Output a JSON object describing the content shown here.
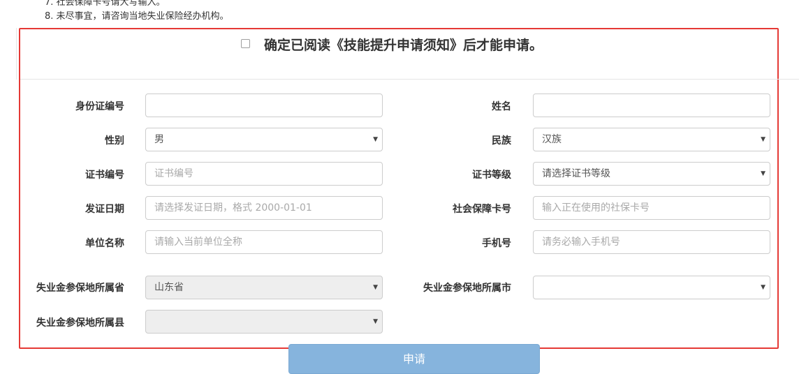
{
  "notes": [
    "7. 社会保障卡号请大写输入。",
    "8. 未尽事宜，请咨询当地失业保险经办机构。"
  ],
  "agreement": {
    "text": "确定已阅读《技能提升申请须知》后才能申请。",
    "checked": false
  },
  "form": {
    "id_number": {
      "label": "身份证编号",
      "value": ""
    },
    "name": {
      "label": "姓名",
      "value": ""
    },
    "gender": {
      "label": "性别",
      "value": "男"
    },
    "ethnicity": {
      "label": "民族",
      "value": "汉族"
    },
    "cert_number": {
      "label": "证书编号",
      "placeholder": "证书编号"
    },
    "cert_level": {
      "label": "证书等级",
      "value": "请选择证书等级"
    },
    "issue_date": {
      "label": "发证日期",
      "placeholder": "请选择发证日期，格式 2000-01-01"
    },
    "social_card": {
      "label": "社会保障卡号",
      "placeholder": "输入正在使用的社保卡号"
    },
    "employer": {
      "label": "单位名称",
      "placeholder": "请输入当前单位全称"
    },
    "phone": {
      "label": "手机号",
      "placeholder": "请务必输入手机号"
    },
    "province": {
      "label": "失业金参保地所属省",
      "value": "山东省"
    },
    "city": {
      "label": "失业金参保地所属市",
      "value": ""
    },
    "county": {
      "label": "失业金参保地所属县",
      "value": ""
    }
  },
  "submit_label": "申请",
  "colors": {
    "highlight": "#e53935",
    "submit_bg": "#86b4dd"
  }
}
